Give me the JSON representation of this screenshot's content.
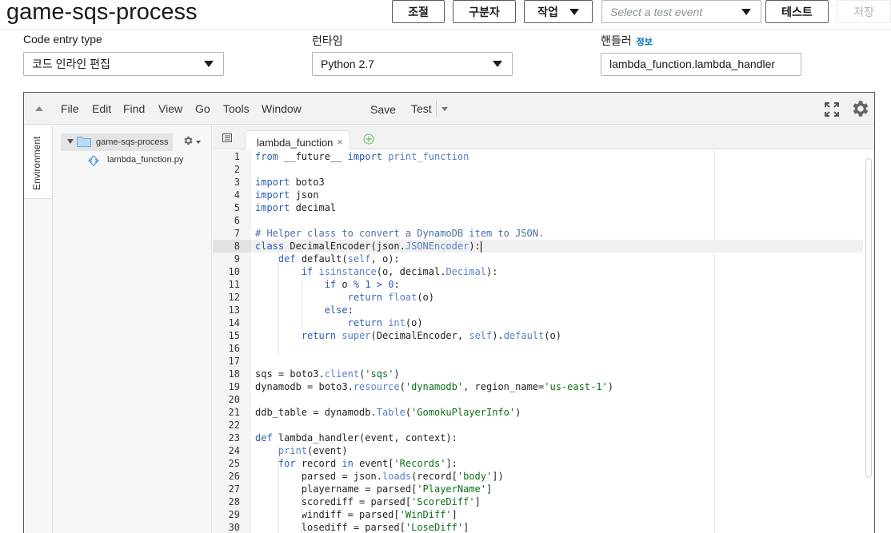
{
  "header": {
    "function_name": "game-sqs-process",
    "buttons": {
      "throttle": "조절",
      "qualifiers": "구분자",
      "actions": "작업",
      "test": "테스트",
      "save": "저장"
    },
    "test_event_placeholder": "Select a test event"
  },
  "config": {
    "code_entry_label": "Code entry type",
    "code_entry_value": "코드 인라인 편집",
    "runtime_label": "런타임",
    "runtime_value": "Python 2.7",
    "handler_label": "핸들러",
    "handler_info": "정보",
    "handler_value": "lambda_function.lambda_handler"
  },
  "ide": {
    "menu": [
      "File",
      "Edit",
      "Find",
      "View",
      "Go",
      "Tools",
      "Window"
    ],
    "save_label": "Save",
    "test_label": "Test",
    "environment_label": "Environment",
    "tree": {
      "root_folder": "game-sqs-process",
      "file": "lambda_function.py"
    },
    "active_tab": "lambda_function",
    "active_line": 8,
    "code_lines": [
      "from __future__ import print_function",
      "",
      "import boto3",
      "import json",
      "import decimal",
      "",
      "# Helper class to convert a DynamoDB item to JSON.",
      "class DecimalEncoder(json.JSONEncoder):",
      "    def default(self, o):",
      "        if isinstance(o, decimal.Decimal):",
      "            if o % 1 > 0:",
      "                return float(o)",
      "            else:",
      "                return int(o)",
      "        return super(DecimalEncoder, self).default(o)",
      "",
      "",
      "sqs = boto3.client('sqs')",
      "dynamodb = boto3.resource('dynamodb', region_name='us-east-1')",
      "",
      "ddb_table = dynamodb.Table('GomokuPlayerInfo')",
      "",
      "def lambda_handler(event, context):",
      "    print(event)",
      "    for record in event['Records']:",
      "        parsed = json.loads(record['body'])",
      "        playername = parsed['PlayerName']",
      "        scorediff = parsed['ScoreDiff']",
      "        windiff = parsed['WinDiff']",
      "        losediff = parsed['LoseDiff']"
    ]
  }
}
